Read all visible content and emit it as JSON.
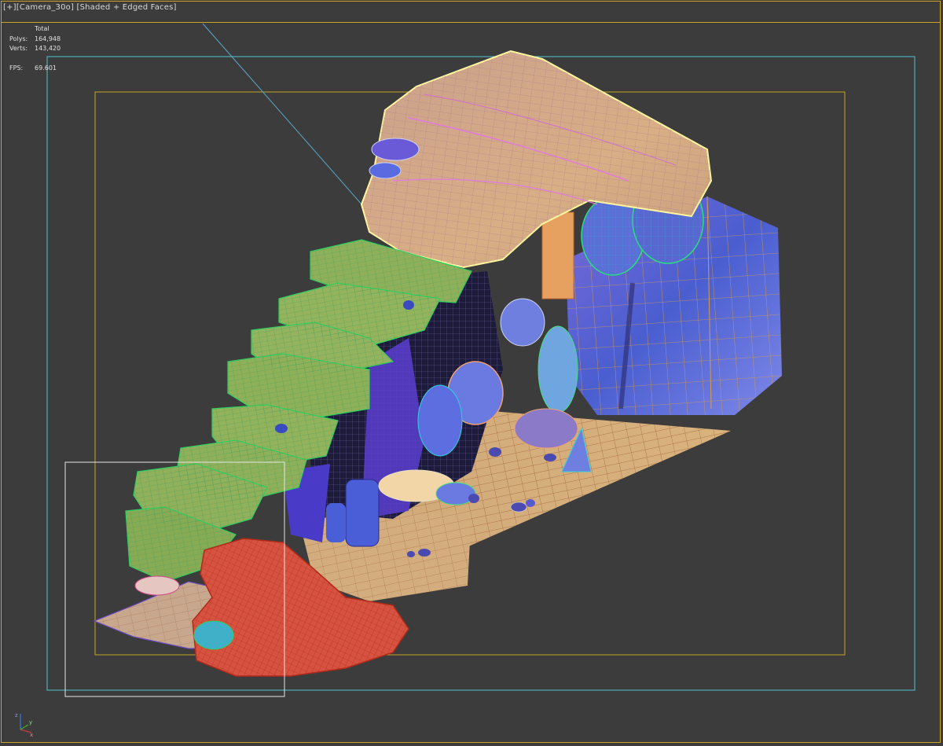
{
  "viewport": {
    "label_plus": "[+]",
    "label_camera": "[Camera_30o]",
    "label_mode": "[Shaded + Edged Faces]"
  },
  "stats": {
    "header": "Total",
    "polys_label": "Polys:",
    "polys_value": "164,948",
    "verts_label": "Verts:",
    "verts_value": "143,420",
    "fps_label": "FPS:",
    "fps_value": "69.601"
  },
  "colors": {
    "viewport_bg": "#3c3c3c",
    "active_border": "#c9a227",
    "safe_frame_outer": "#4fc3cf",
    "safe_frame_inner": "#c9a227",
    "selection_rect": "#e6e6e6",
    "plateau_top": "#d9ad82",
    "green_ledges": "#8fb05a",
    "rock_blue": "#5b6fd6",
    "red_ground": "#d04a3a",
    "sand_floor": "#d2a870"
  },
  "axis_gizmo": {
    "x_label": "x",
    "y_label": "y",
    "z_label": "z"
  }
}
